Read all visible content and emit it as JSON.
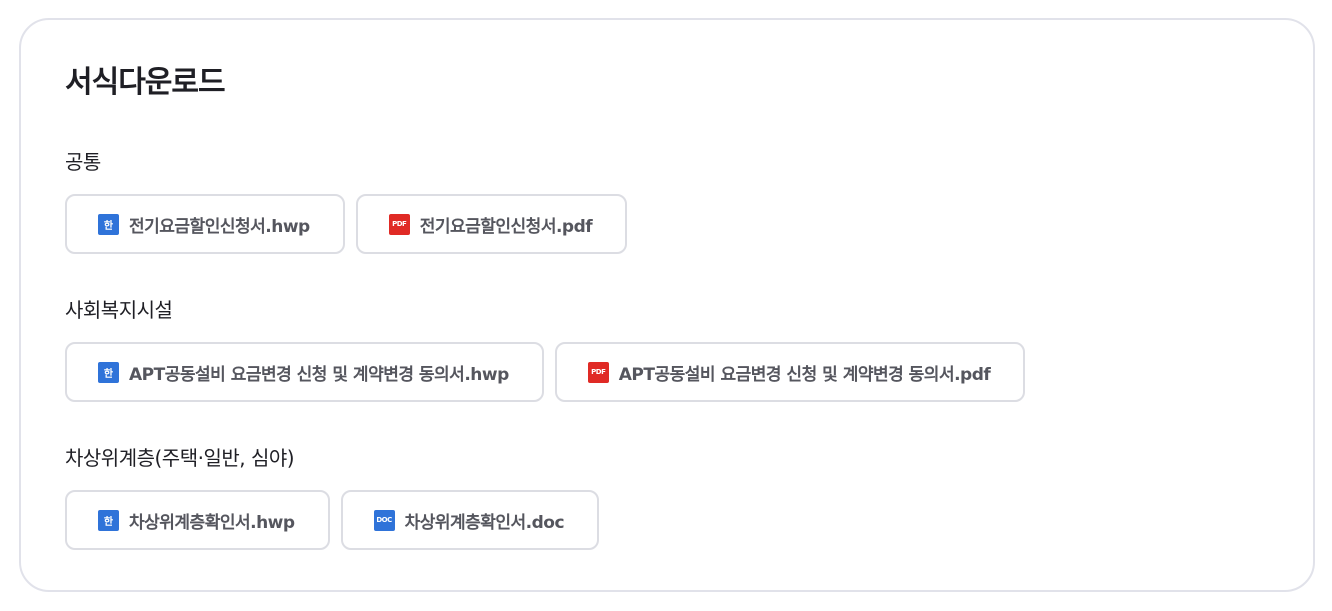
{
  "page_title": "서식다운로드",
  "sections": [
    {
      "title": "공통",
      "files": [
        {
          "icon": "hwp-icon",
          "icon_text": "한",
          "label": "전기요금할인신청서.hwp"
        },
        {
          "icon": "pdf-icon",
          "icon_text": "PDF",
          "label": "전기요금할인신청서.pdf"
        }
      ]
    },
    {
      "title": "사회복지시설",
      "files": [
        {
          "icon": "hwp-icon",
          "icon_text": "한",
          "label": "APT공동설비 요금변경 신청 및 계약변경 동의서.hwp"
        },
        {
          "icon": "pdf-icon",
          "icon_text": "PDF",
          "label": "APT공동설비 요금변경 신청 및 계약변경 동의서.pdf"
        }
      ]
    },
    {
      "title": "차상위계층(주택·일반, 심야)",
      "files": [
        {
          "icon": "hwp-icon",
          "icon_text": "한",
          "label": "차상위계층확인서.hwp"
        },
        {
          "icon": "doc-icon",
          "icon_text": "DOC",
          "label": "차상위계층확인서.doc"
        }
      ]
    }
  ],
  "colors": {
    "hwp_icon": "#2f73d9",
    "pdf_icon": "#e02a25",
    "doc_icon": "#2f73d9",
    "border": "#dcdde3",
    "label_text": "#55565e",
    "heading_text": "#1f1f25"
  }
}
